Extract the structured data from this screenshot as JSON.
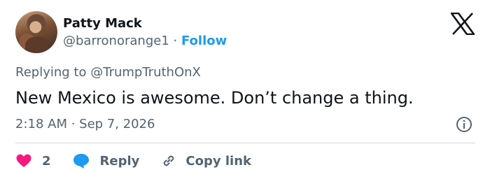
{
  "author": {
    "name": "Patty Mack",
    "handle": "@barronorange1",
    "separator": "·",
    "follow_label": "Follow"
  },
  "tweet": {
    "replying_prefix": "Replying to",
    "replying_to": "@TrumpTruthOnX",
    "text": "New Mexico is awesome. Don’t change a thing.",
    "timestamp": "2:18 AM · Sep 7, 2026"
  },
  "actions": {
    "like_count": "2",
    "reply_label": "Reply",
    "copy_link_label": "Copy link"
  },
  "colors": {
    "accent": "#1d9bf0",
    "like": "#f91880",
    "muted": "#536471",
    "text": "#0f1419",
    "divider": "#cfd9de"
  }
}
